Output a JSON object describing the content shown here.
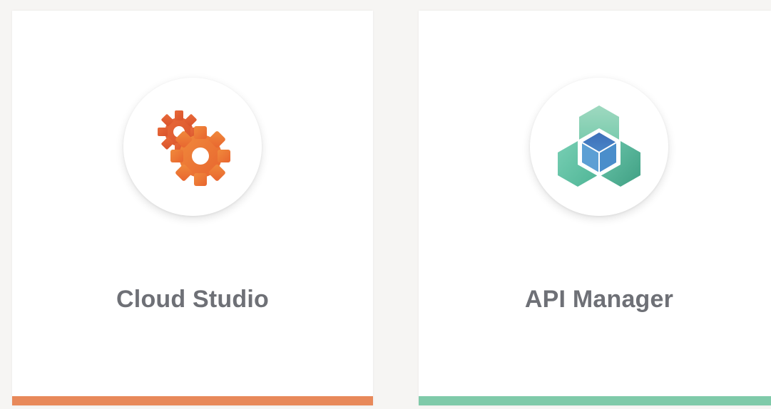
{
  "cards": [
    {
      "title": "Cloud Studio",
      "icon": "gears-icon",
      "accent_color": "#e8895a"
    },
    {
      "title": "API Manager",
      "icon": "hexagon-cube-icon",
      "accent_color": "#7fcaa9"
    }
  ],
  "colors": {
    "background": "#f6f5f3",
    "card": "#ffffff",
    "title_text": "#6e7076"
  }
}
